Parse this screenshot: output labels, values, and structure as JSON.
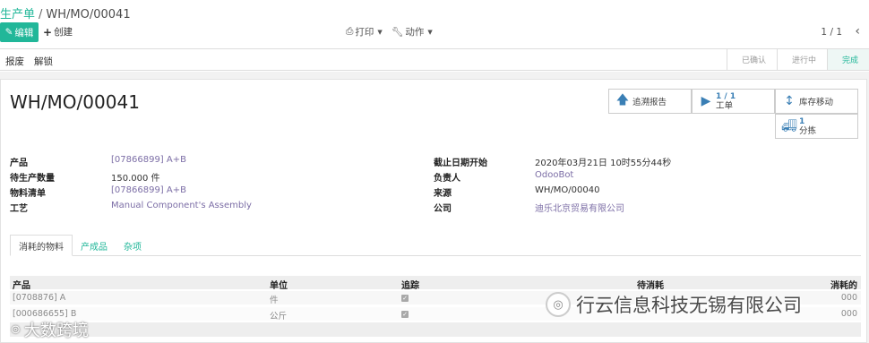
{
  "breadcrumb": {
    "parent": "生产单",
    "separator": "/",
    "current": "WH/MO/00041"
  },
  "toolbar": {
    "edit_label": "编辑",
    "create_label": "创建",
    "print_label": "打印",
    "action_label": "动作",
    "pager": "1 / 1"
  },
  "statusbar": {
    "buttons": [
      "报废",
      "解锁"
    ],
    "stages": [
      "已确认",
      "进行中",
      "完成"
    ],
    "active_stage": "完成"
  },
  "record": {
    "name": "WH/MO/00041"
  },
  "smart_buttons": {
    "trace": {
      "label": "追溯报告"
    },
    "workorders": {
      "count": "1 / 1",
      "label": "工单"
    },
    "stock_moves": {
      "label": "库存移动"
    },
    "picking": {
      "count": "1",
      "label": "分拣"
    }
  },
  "fields_left": [
    {
      "label": "产品",
      "value": "[07866899] A+B"
    },
    {
      "label": "待生产数量",
      "value": "150.000 件"
    },
    {
      "label": "物料清单",
      "value": "[07866899] A+B"
    },
    {
      "label": "工艺",
      "value": "Manual Component's Assembly"
    }
  ],
  "fields_right": [
    {
      "label": "截止日期开始",
      "value": "2020年03月21日 10时55分44秒"
    },
    {
      "label": "负责人",
      "value": "OdooBot"
    },
    {
      "label": "来源",
      "value": "WH/MO/00040"
    },
    {
      "label": "公司",
      "value": "迪乐北京贸易有限公司"
    }
  ],
  "tabs": [
    "消耗的物料",
    "产成品",
    "杂项"
  ],
  "table": {
    "columns": [
      "产品",
      "单位",
      "追踪",
      "待消耗",
      "消耗的"
    ],
    "rows": [
      {
        "product": "[0708876] A",
        "unit": "件",
        "tracked": true,
        "to_consume": "",
        "consumed": "000"
      },
      {
        "product": "[000686655] B",
        "unit": "公斤",
        "tracked": true,
        "to_consume": "",
        "consumed": "000"
      }
    ]
  },
  "watermarks": {
    "right": "行云信息科技无锡有限公司",
    "left": "大数跨境"
  },
  "colors": {
    "accent": "#21b799",
    "link": "#7c6ea6",
    "icon": "#3a7fb5"
  }
}
